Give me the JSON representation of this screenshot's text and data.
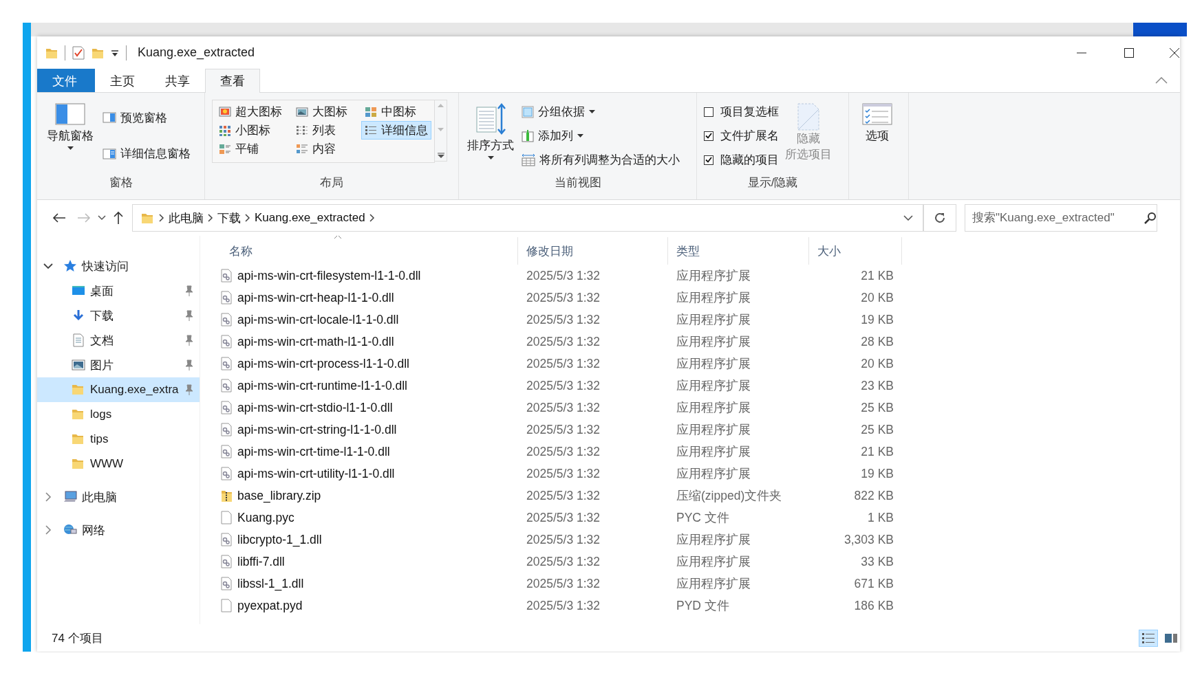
{
  "window": {
    "title": "Kuang.exe_extracted"
  },
  "ribbon_tabs": [
    {
      "label": "文件",
      "kind": "file",
      "selected": false
    },
    {
      "label": "主页",
      "kind": "tab",
      "selected": false
    },
    {
      "label": "共享",
      "kind": "tab",
      "selected": false
    },
    {
      "label": "查看",
      "kind": "tab",
      "selected": true
    }
  ],
  "panes_group": {
    "label": "窗格",
    "navigation_pane": "导航窗格",
    "preview_pane": "预览窗格",
    "details_pane": "详细信息窗格"
  },
  "layout_group": {
    "label": "布局",
    "options": [
      {
        "label": "超大图标",
        "kind": "extra-large",
        "selected": false
      },
      {
        "label": "大图标",
        "kind": "large",
        "selected": false
      },
      {
        "label": "中图标",
        "kind": "medium",
        "selected": false
      },
      {
        "label": "小图标",
        "kind": "small",
        "selected": false
      },
      {
        "label": "列表",
        "kind": "list",
        "selected": false
      },
      {
        "label": "详细信息",
        "kind": "details",
        "selected": true
      },
      {
        "label": "平铺",
        "kind": "tiles",
        "selected": false
      },
      {
        "label": "内容",
        "kind": "content",
        "selected": false
      }
    ]
  },
  "current_view_group": {
    "label": "当前视图",
    "sort_by": "排序方式",
    "group_by": "分组依据",
    "add_columns": "添加列",
    "size_columns": "将所有列调整为合适的大小"
  },
  "show_hide_group": {
    "label": "显示/隐藏",
    "checkboxes": [
      {
        "label": "项目复选框",
        "checked": false
      },
      {
        "label": "文件扩展名",
        "checked": true
      },
      {
        "label": "隐藏的项目",
        "checked": true
      }
    ],
    "hide_selected": {
      "lines": [
        "隐藏",
        "所选项目"
      ],
      "disabled": true
    }
  },
  "options_button": "选项",
  "address": {
    "crumbs": [
      "此电脑",
      "下载",
      "Kuang.exe_extracted"
    ]
  },
  "search": {
    "placeholder": "搜索\"Kuang.exe_extracted\""
  },
  "nav_tree": [
    {
      "label": "快速访问",
      "kind": "quick",
      "expanded": true,
      "selected": false,
      "children": [
        {
          "label": "桌面",
          "kind": "desktop",
          "pinned": true,
          "selected": false
        },
        {
          "label": "下载",
          "kind": "downloads",
          "pinned": true,
          "selected": false
        },
        {
          "label": "文档",
          "kind": "documents",
          "pinned": true,
          "selected": false
        },
        {
          "label": "图片",
          "kind": "pictures",
          "pinned": true,
          "selected": false
        },
        {
          "label": "Kuang.exe_extra",
          "kind": "folder",
          "pinned": true,
          "selected": true
        },
        {
          "label": "logs",
          "kind": "folder",
          "pinned": false,
          "selected": false
        },
        {
          "label": "tips",
          "kind": "folder",
          "pinned": false,
          "selected": false
        },
        {
          "label": "WWW",
          "kind": "folder",
          "pinned": false,
          "selected": false
        }
      ]
    },
    {
      "label": "此电脑",
      "kind": "pc",
      "expanded": false,
      "selected": false
    },
    {
      "label": "网络",
      "kind": "network",
      "expanded": false,
      "selected": false
    }
  ],
  "table": {
    "columns": [
      {
        "label": "名称",
        "sorted": true
      },
      {
        "label": "修改日期",
        "sorted": false
      },
      {
        "label": "类型",
        "sorted": false
      },
      {
        "label": "大小",
        "sorted": false
      }
    ],
    "rows": [
      {
        "name": "api-ms-win-crt-filesystem-l1-1-0.dll",
        "kind": "dll",
        "date": "2025/5/3 1:32",
        "type": "应用程序扩展",
        "size": "21 KB"
      },
      {
        "name": "api-ms-win-crt-heap-l1-1-0.dll",
        "kind": "dll",
        "date": "2025/5/3 1:32",
        "type": "应用程序扩展",
        "size": "20 KB"
      },
      {
        "name": "api-ms-win-crt-locale-l1-1-0.dll",
        "kind": "dll",
        "date": "2025/5/3 1:32",
        "type": "应用程序扩展",
        "size": "19 KB"
      },
      {
        "name": "api-ms-win-crt-math-l1-1-0.dll",
        "kind": "dll",
        "date": "2025/5/3 1:32",
        "type": "应用程序扩展",
        "size": "28 KB"
      },
      {
        "name": "api-ms-win-crt-process-l1-1-0.dll",
        "kind": "dll",
        "date": "2025/5/3 1:32",
        "type": "应用程序扩展",
        "size": "20 KB"
      },
      {
        "name": "api-ms-win-crt-runtime-l1-1-0.dll",
        "kind": "dll",
        "date": "2025/5/3 1:32",
        "type": "应用程序扩展",
        "size": "23 KB"
      },
      {
        "name": "api-ms-win-crt-stdio-l1-1-0.dll",
        "kind": "dll",
        "date": "2025/5/3 1:32",
        "type": "应用程序扩展",
        "size": "25 KB"
      },
      {
        "name": "api-ms-win-crt-string-l1-1-0.dll",
        "kind": "dll",
        "date": "2025/5/3 1:32",
        "type": "应用程序扩展",
        "size": "25 KB"
      },
      {
        "name": "api-ms-win-crt-time-l1-1-0.dll",
        "kind": "dll",
        "date": "2025/5/3 1:32",
        "type": "应用程序扩展",
        "size": "21 KB"
      },
      {
        "name": "api-ms-win-crt-utility-l1-1-0.dll",
        "kind": "dll",
        "date": "2025/5/3 1:32",
        "type": "应用程序扩展",
        "size": "19 KB"
      },
      {
        "name": "base_library.zip",
        "kind": "zip",
        "date": "2025/5/3 1:32",
        "type": "压缩(zipped)文件夹",
        "size": "822 KB"
      },
      {
        "name": "Kuang.pyc",
        "kind": "file",
        "date": "2025/5/3 1:32",
        "type": "PYC 文件",
        "size": "1 KB"
      },
      {
        "name": "libcrypto-1_1.dll",
        "kind": "dll",
        "date": "2025/5/3 1:32",
        "type": "应用程序扩展",
        "size": "3,303 KB"
      },
      {
        "name": "libffi-7.dll",
        "kind": "dll",
        "date": "2025/5/3 1:32",
        "type": "应用程序扩展",
        "size": "33 KB"
      },
      {
        "name": "libssl-1_1.dll",
        "kind": "dll",
        "date": "2025/5/3 1:32",
        "type": "应用程序扩展",
        "size": "671 KB"
      },
      {
        "name": "pyexpat.pyd",
        "kind": "file",
        "date": "2025/5/3 1:32",
        "type": "PYD 文件",
        "size": "186 KB"
      }
    ]
  },
  "status_bar": {
    "item_count": "74 个项目",
    "view_buttons": [
      {
        "kind": "details",
        "selected": true
      },
      {
        "kind": "thumbnails",
        "selected": false
      }
    ]
  }
}
